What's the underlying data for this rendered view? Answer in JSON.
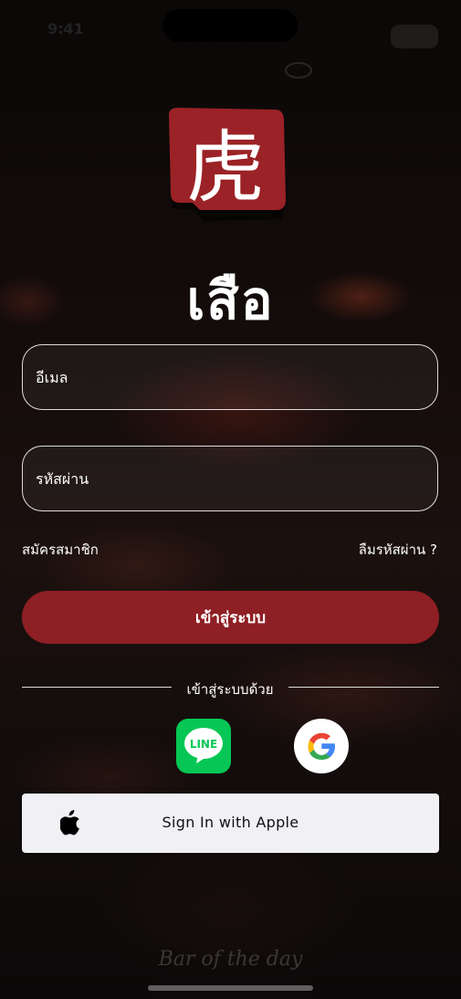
{
  "status_bar": {
    "time": "9:41"
  },
  "brand": {
    "logo_glyph": "虎",
    "title": "เสือ",
    "logo_color": "#9b2226"
  },
  "form": {
    "email_placeholder": "อีเมล",
    "password_placeholder": "รหัสผ่าน",
    "register_link": "สมัครสมาชิก",
    "forgot_link": "ลืมรหัสผ่าน ?",
    "login_button": "เข้าสู่ระบบ",
    "login_button_color": "#8e1f24"
  },
  "social_login": {
    "divider_label": "เข้าสู่ระบบด้วย",
    "line_label": "LINE",
    "line_color": "#06c755",
    "google_icon": "google-g-icon",
    "apple_button": "Sign In with Apple",
    "apple_icon": "apple-icon"
  },
  "footer": {
    "watermark": "Bar of the day"
  }
}
